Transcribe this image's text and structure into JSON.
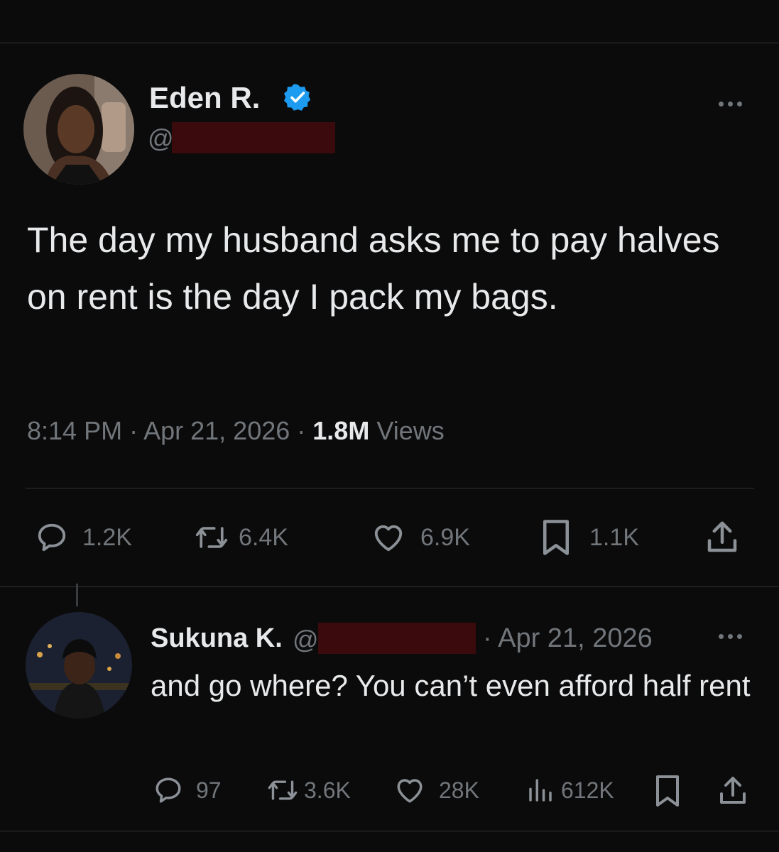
{
  "tweet": {
    "author": {
      "name": "Eden R.",
      "handle_prefix": "@",
      "verified": true
    },
    "text": "The day my husband asks me to pay halves on rent is the day I pack my bags.",
    "time": "8:14 PM",
    "date": "Apr 21, 2026",
    "views_count": "1.8M",
    "views_label": "Views",
    "actions": {
      "replies": "1.2K",
      "reposts": "6.4K",
      "likes": "6.9K",
      "bookmarks": "1.1K"
    }
  },
  "reply": {
    "author": {
      "name": "Sukuna K.",
      "handle_prefix": "@"
    },
    "date": "· Apr 21, 2026",
    "text": "and go where? You can’t even afford half rent",
    "actions": {
      "replies": "97",
      "reposts": "3.6K",
      "likes": "28K",
      "views": "612K"
    }
  },
  "icons": {
    "verified": "verified-badge-icon",
    "reply": "reply-icon",
    "repost": "repost-icon",
    "like": "heart-icon",
    "bookmark": "bookmark-icon",
    "share": "share-icon",
    "views": "views-icon",
    "more": "more-icon"
  },
  "colors": {
    "background": "#0b0b0c",
    "text": "#e7e9ea",
    "muted": "#71767b",
    "divider": "#2f3336",
    "verified": "#1d9bf0",
    "redaction": "#3a0a0c"
  }
}
